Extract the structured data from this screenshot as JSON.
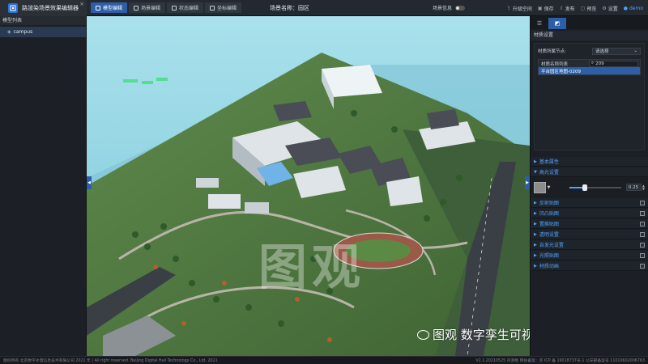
{
  "app": {
    "title": "路渲染场景效果编辑器",
    "close_glyph": "×",
    "mode_tabs": [
      {
        "label": "模型编辑",
        "active": true
      },
      {
        "label": "场景编辑",
        "active": false
      },
      {
        "label": "状态编辑",
        "active": false
      },
      {
        "label": "坐标编辑",
        "active": false
      }
    ],
    "scene_name": "场景名称：园区",
    "scene_info_label": "场景信息",
    "actions": [
      {
        "icon": "upgrade-icon",
        "label": "升级空间"
      },
      {
        "icon": "save-icon",
        "label": "保存"
      },
      {
        "icon": "publish-icon",
        "label": "发布"
      },
      {
        "icon": "preview-icon",
        "label": "预览"
      },
      {
        "icon": "settings-icon",
        "label": "设置"
      }
    ],
    "user": "demo"
  },
  "left_panel": {
    "header": "模型列表",
    "items": [
      {
        "label": "campus"
      }
    ]
  },
  "viewport": {
    "watermark": "图观",
    "wechat_caption": "图观 数字孪生可视化引擎"
  },
  "right_panel": {
    "section_title": "材质设置",
    "material_node_label": "材质所属节点:",
    "material_node_value": "请选择",
    "table_header": "材质名称列表",
    "search_value": "209",
    "selected_material": "平台园区地图-0209",
    "accordions_top": [
      {
        "label": "基本属性",
        "checkbox": false
      },
      {
        "label": "高光设置",
        "checkbox": false,
        "expanded": true
      }
    ],
    "highlight": {
      "value_text": "0.25",
      "value": 0.25,
      "max": 1
    },
    "accordions_bottom": [
      {
        "label": "反射贴图"
      },
      {
        "label": "凹凸贴图"
      },
      {
        "label": "置换贴图"
      },
      {
        "label": "透明设置"
      },
      {
        "label": "自发光设置"
      },
      {
        "label": "光照贴图"
      },
      {
        "label": "材质动画"
      }
    ]
  },
  "footer": {
    "left": "版权所有 北京数字冰雹信息技术有限公司 2021 年 | All right reserved. Beijing Digital Hail Technology Co., Ltd. 2021",
    "right": "V2.1.20210525 内测版 网站备案：京 ICP 备 19018737号-1 公安部备案号 11010602006763"
  },
  "colors": {
    "accent": "#2d5fa8",
    "link": "#4ea1ff",
    "panel_bg": "#1c2026"
  }
}
